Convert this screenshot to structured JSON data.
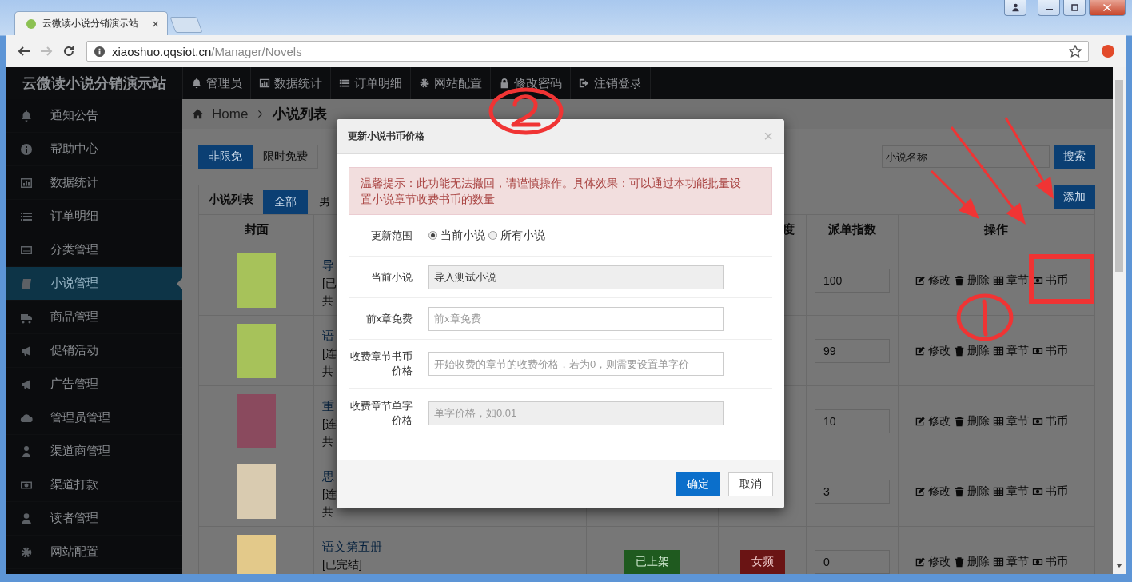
{
  "browser": {
    "tab_title": "云微读小说分销演示站",
    "tab_close": "×",
    "url_host": "xiaoshuo.qqsiot.cn",
    "url_path": "/Manager/Novels"
  },
  "brand": "云微读小说分销演示站",
  "top_nav": [
    {
      "label": "管理员"
    },
    {
      "label": "数据统计"
    },
    {
      "label": "订单明细"
    },
    {
      "label": "网站配置"
    },
    {
      "label": "修改密码"
    },
    {
      "label": "注销登录"
    }
  ],
  "sidebar": {
    "items": [
      {
        "label": "通知公告",
        "selected": false
      },
      {
        "label": "帮助中心",
        "selected": false
      },
      {
        "label": "数据统计",
        "selected": false
      },
      {
        "label": "订单明细",
        "selected": false
      },
      {
        "label": "分类管理",
        "selected": false
      },
      {
        "label": "小说管理",
        "selected": true
      },
      {
        "label": "商品管理",
        "selected": false
      },
      {
        "label": "促销活动",
        "selected": false
      },
      {
        "label": "广告管理",
        "selected": false
      },
      {
        "label": "管理员管理",
        "selected": false
      },
      {
        "label": "渠道商管理",
        "selected": false
      },
      {
        "label": "渠道打款",
        "selected": false
      },
      {
        "label": "读者管理",
        "selected": false
      },
      {
        "label": "网站配置",
        "selected": false
      }
    ]
  },
  "breadcrumb": {
    "home": "Home",
    "current": "小说列表"
  },
  "filter_tabs": [
    {
      "label": "非限免",
      "selected": true
    },
    {
      "label": "限时免费",
      "selected": false
    }
  ],
  "search": {
    "placeholder": "小说名称",
    "button": "搜索"
  },
  "panel": {
    "title": "小说列表",
    "tabs": [
      {
        "label": "全部",
        "selected": true
      },
      {
        "label": "男",
        "selected": false
      }
    ],
    "add_button": "添加"
  },
  "table": {
    "columns": {
      "cover": "封面",
      "column_4": "度",
      "dispatch_index": "派单指数",
      "actions": "操作"
    },
    "rows": [
      {
        "title": "导",
        "status": "[已",
        "chapters": "共",
        "dispatch_index": "100",
        "actions": [
          "修改",
          "删除",
          "章节",
          "书币"
        ]
      },
      {
        "title": "语",
        "status": "[连",
        "chapters": "共",
        "dispatch_index": "99",
        "actions": [
          "修改",
          "删除",
          "章节",
          "书币"
        ]
      },
      {
        "title": "重",
        "status": "[连",
        "chapters": "共",
        "dispatch_index": "10",
        "actions": [
          "修改",
          "删除",
          "章节",
          "书币"
        ]
      },
      {
        "title": "思",
        "status": "[连",
        "chapters": "共",
        "dispatch_index": "3",
        "actions": [
          "修改",
          "删除",
          "章节",
          "书币"
        ]
      },
      {
        "title": "语文第五册",
        "status": "[已完结]",
        "shelf": "已上架",
        "channel": "女频",
        "dispatch_index": "0",
        "actions": [
          "修改",
          "删除",
          "章节",
          "书币"
        ]
      }
    ]
  },
  "modal": {
    "title": "更新小说书币价格",
    "close": "×",
    "alert": "温馨提示：此功能无法撤回，请谨慎操作。具体效果：可以通过本功能批量设置小说章节收费书币的数量",
    "fields": [
      {
        "kind": "radio",
        "label": "更新范围",
        "options": [
          {
            "label": "当前小说",
            "selected": true
          },
          {
            "label": "所有小说",
            "selected": false
          }
        ]
      },
      {
        "kind": "input",
        "label": "当前小说",
        "value": "导入测试小说",
        "disabled": true
      },
      {
        "kind": "input",
        "label": "前x章免费",
        "placeholder": "前x章免费",
        "disabled": false
      },
      {
        "kind": "input",
        "label": "收费章节书币价格",
        "placeholder": "开始收费的章节的收费价格，若为0，则需要设置单字价",
        "disabled": false
      },
      {
        "kind": "input",
        "label": "收费章节单字价格",
        "placeholder": "单字价格，如0.01",
        "disabled": true
      }
    ],
    "buttons": [
      {
        "label": "确定",
        "primary": true
      },
      {
        "label": "取消",
        "primary": false
      }
    ]
  },
  "annotations": [
    {
      "kind": "circled_two"
    },
    {
      "kind": "arrow"
    },
    {
      "kind": "arrow"
    },
    {
      "kind": "arrow"
    },
    {
      "kind": "box"
    },
    {
      "kind": "circled_one"
    }
  ]
}
